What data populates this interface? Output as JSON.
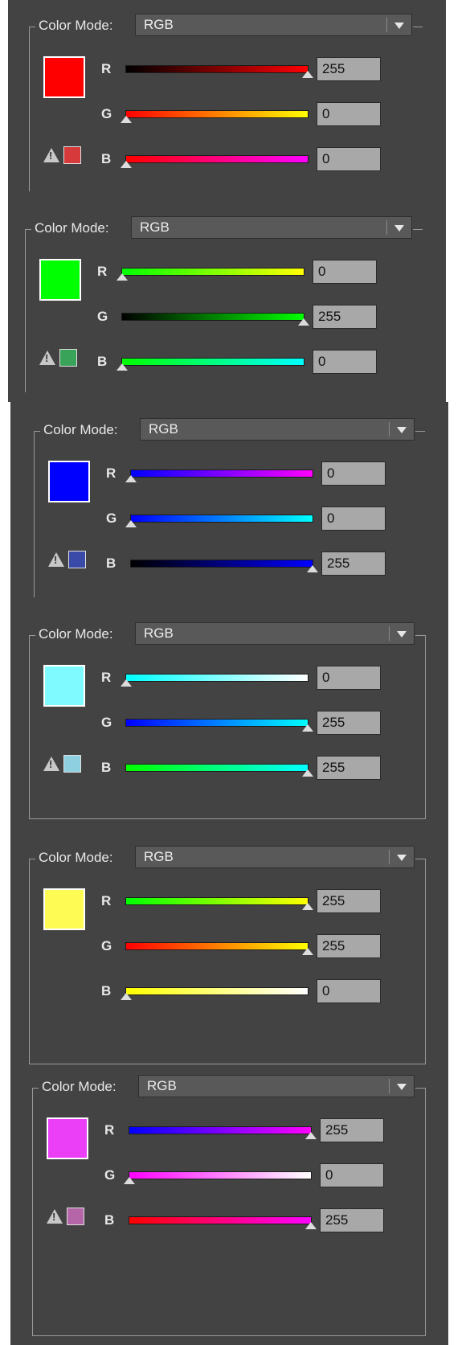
{
  "panels": [
    {
      "mode_label": "Color Mode:",
      "mode_value": "RGB",
      "swatch_color": "#ff0000",
      "gamut_warning": true,
      "gamut_color": "#d63a3a",
      "channels": [
        {
          "label": "R",
          "value": "255",
          "fraction": 1.0,
          "gradient": "linear-gradient(to right,#000000,#ff0000)"
        },
        {
          "label": "G",
          "value": "0",
          "fraction": 0.0,
          "gradient": "linear-gradient(to right,#ff0000,#ffff00)"
        },
        {
          "label": "B",
          "value": "0",
          "fraction": 0.0,
          "gradient": "linear-gradient(to right,#ff0000,#ff00ff)"
        }
      ]
    },
    {
      "mode_label": "Color Mode:",
      "mode_value": "RGB",
      "swatch_color": "#00ff00",
      "gamut_warning": true,
      "gamut_color": "#3aa35a",
      "channels": [
        {
          "label": "R",
          "value": "0",
          "fraction": 0.0,
          "gradient": "linear-gradient(to right,#00ff00,#ffff00)"
        },
        {
          "label": "G",
          "value": "255",
          "fraction": 1.0,
          "gradient": "linear-gradient(to right,#000000,#00ff00)"
        },
        {
          "label": "B",
          "value": "0",
          "fraction": 0.0,
          "gradient": "linear-gradient(to right,#00ff00,#00ffff)"
        }
      ]
    },
    {
      "mode_label": "Color Mode:",
      "mode_value": "RGB",
      "swatch_color": "#0000ff",
      "gamut_warning": true,
      "gamut_color": "#3a4aa8",
      "channels": [
        {
          "label": "R",
          "value": "0",
          "fraction": 0.0,
          "gradient": "linear-gradient(to right,#0000ff,#ff00ff)"
        },
        {
          "label": "G",
          "value": "0",
          "fraction": 0.0,
          "gradient": "linear-gradient(to right,#0000ff,#00ffff)"
        },
        {
          "label": "B",
          "value": "255",
          "fraction": 1.0,
          "gradient": "linear-gradient(to right,#000000,#0000ff)"
        }
      ]
    },
    {
      "mode_label": "Color Mode:",
      "mode_value": "RGB",
      "swatch_color": "#7ffbff",
      "gamut_warning": true,
      "gamut_color": "#8fd0e0",
      "channels": [
        {
          "label": "R",
          "value": "0",
          "fraction": 0.0,
          "gradient": "linear-gradient(to right,#00ffff,#ffffff)"
        },
        {
          "label": "G",
          "value": "255",
          "fraction": 1.0,
          "gradient": "linear-gradient(to right,#0000ff,#00ffff)"
        },
        {
          "label": "B",
          "value": "255",
          "fraction": 1.0,
          "gradient": "linear-gradient(to right,#00ff00,#00ffff)"
        }
      ]
    },
    {
      "mode_label": "Color Mode:",
      "mode_value": "RGB",
      "swatch_color": "#fffb55",
      "gamut_warning": false,
      "gamut_color": "",
      "channels": [
        {
          "label": "R",
          "value": "255",
          "fraction": 1.0,
          "gradient": "linear-gradient(to right,#00ff00,#ffff00)"
        },
        {
          "label": "G",
          "value": "255",
          "fraction": 1.0,
          "gradient": "linear-gradient(to right,#ff0000,#ffff00)"
        },
        {
          "label": "B",
          "value": "0",
          "fraction": 0.0,
          "gradient": "linear-gradient(to right,#ffff00,#ffffff)"
        }
      ]
    },
    {
      "mode_label": "Color Mode:",
      "mode_value": "RGB",
      "swatch_color": "#ea3ff7",
      "gamut_warning": true,
      "gamut_color": "#b566a8",
      "channels": [
        {
          "label": "R",
          "value": "255",
          "fraction": 1.0,
          "gradient": "linear-gradient(to right,#0000ff,#ff00ff)"
        },
        {
          "label": "G",
          "value": "0",
          "fraction": 0.0,
          "gradient": "linear-gradient(to right,#ff00ff,#ffffff)"
        },
        {
          "label": "B",
          "value": "255",
          "fraction": 1.0,
          "gradient": "linear-gradient(to right,#ff0000,#ff00ff)"
        }
      ]
    }
  ]
}
